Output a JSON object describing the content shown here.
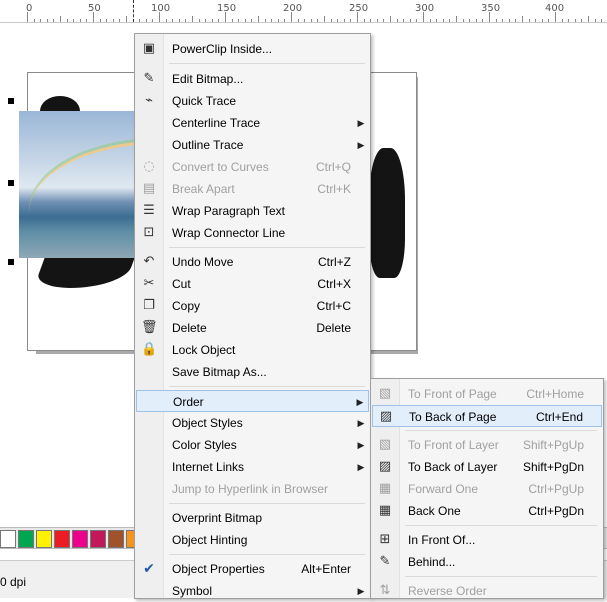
{
  "ruler": {
    "labels": [
      "0",
      "50",
      "100",
      "150",
      "200",
      "250",
      "300",
      "350",
      "400"
    ]
  },
  "context_menu": {
    "items": [
      {
        "label": "PowerClip Inside...",
        "shortcut": "",
        "icon": "powerclip-icon",
        "enabled": true,
        "submenu": false
      },
      {
        "label": "Edit Bitmap...",
        "shortcut": "",
        "icon": "edit-bitmap-icon",
        "enabled": true,
        "submenu": false
      },
      {
        "label": "Quick Trace",
        "shortcut": "",
        "icon": "quick-trace-icon",
        "enabled": true,
        "submenu": false
      },
      {
        "label": "Centerline Trace",
        "shortcut": "",
        "icon": "",
        "enabled": true,
        "submenu": true
      },
      {
        "label": "Outline Trace",
        "shortcut": "",
        "icon": "",
        "enabled": true,
        "submenu": true
      },
      {
        "label": "Convert to Curves",
        "shortcut": "Ctrl+Q",
        "icon": "convert-curves-icon",
        "enabled": false,
        "submenu": false
      },
      {
        "label": "Break Apart",
        "shortcut": "Ctrl+K",
        "icon": "break-apart-icon",
        "enabled": false,
        "submenu": false
      },
      {
        "label": "Wrap Paragraph Text",
        "shortcut": "",
        "icon": "wrap-text-icon",
        "enabled": true,
        "submenu": false
      },
      {
        "label": "Wrap Connector Line",
        "shortcut": "",
        "icon": "wrap-connector-icon",
        "enabled": true,
        "submenu": false
      },
      {
        "label": "Undo Move",
        "shortcut": "Ctrl+Z",
        "icon": "undo-icon",
        "enabled": true,
        "submenu": false
      },
      {
        "label": "Cut",
        "shortcut": "Ctrl+X",
        "icon": "scissors-icon",
        "enabled": true,
        "submenu": false
      },
      {
        "label": "Copy",
        "shortcut": "Ctrl+C",
        "icon": "copy-icon",
        "enabled": true,
        "submenu": false
      },
      {
        "label": "Delete",
        "shortcut": "Delete",
        "icon": "trash-icon",
        "enabled": true,
        "submenu": false
      },
      {
        "label": "Lock Object",
        "shortcut": "",
        "icon": "lock-icon",
        "enabled": true,
        "submenu": false
      },
      {
        "label": "Save Bitmap As...",
        "shortcut": "",
        "icon": "",
        "enabled": true,
        "submenu": false
      },
      {
        "label": "Order",
        "shortcut": "",
        "icon": "",
        "enabled": true,
        "submenu": true,
        "highlighted": true
      },
      {
        "label": "Object Styles",
        "shortcut": "",
        "icon": "",
        "enabled": true,
        "submenu": true
      },
      {
        "label": "Color Styles",
        "shortcut": "",
        "icon": "",
        "enabled": true,
        "submenu": true
      },
      {
        "label": "Internet Links",
        "shortcut": "",
        "icon": "",
        "enabled": true,
        "submenu": true
      },
      {
        "label": "Jump to Hyperlink in Browser",
        "shortcut": "",
        "icon": "",
        "enabled": false,
        "submenu": false
      },
      {
        "label": "Overprint Bitmap",
        "shortcut": "",
        "icon": "",
        "enabled": true,
        "submenu": false
      },
      {
        "label": "Object Hinting",
        "shortcut": "",
        "icon": "",
        "enabled": true,
        "submenu": false
      },
      {
        "label": "Object Properties",
        "shortcut": "Alt+Enter",
        "icon": "checkmark-icon",
        "enabled": true,
        "submenu": false
      },
      {
        "label": "Symbol",
        "shortcut": "",
        "icon": "",
        "enabled": true,
        "submenu": true
      }
    ]
  },
  "order_submenu": {
    "items": [
      {
        "label": "To Front of Page",
        "shortcut": "Ctrl+Home",
        "icon": "to-front-page-icon",
        "enabled": false
      },
      {
        "label": "To Back of Page",
        "shortcut": "Ctrl+End",
        "icon": "to-back-page-icon",
        "enabled": true,
        "highlighted": true
      },
      {
        "label": "To Front of Layer",
        "shortcut": "Shift+PgUp",
        "icon": "to-front-layer-icon",
        "enabled": false
      },
      {
        "label": "To Back of Layer",
        "shortcut": "Shift+PgDn",
        "icon": "to-back-layer-icon",
        "enabled": true
      },
      {
        "label": "Forward One",
        "shortcut": "Ctrl+PgUp",
        "icon": "forward-one-icon",
        "enabled": false
      },
      {
        "label": "Back One",
        "shortcut": "Ctrl+PgDn",
        "icon": "back-one-icon",
        "enabled": true
      },
      {
        "label": "In Front Of...",
        "shortcut": "",
        "icon": "in-front-of-icon",
        "enabled": true
      },
      {
        "label": "Behind...",
        "shortcut": "",
        "icon": "behind-icon",
        "enabled": true
      },
      {
        "label": "Reverse Order",
        "shortcut": "",
        "icon": "reverse-order-icon",
        "enabled": false
      }
    ]
  },
  "palette": {
    "colors": [
      "#ffffff",
      "#00a650",
      "#fff200",
      "#ed1c24",
      "#ec008c",
      "#c2185b",
      "#a0522d",
      "#f7941d",
      "#f4a6a6",
      "#8c7b6b",
      "#f0f0f0"
    ]
  },
  "status": {
    "text": "0 dpi"
  }
}
